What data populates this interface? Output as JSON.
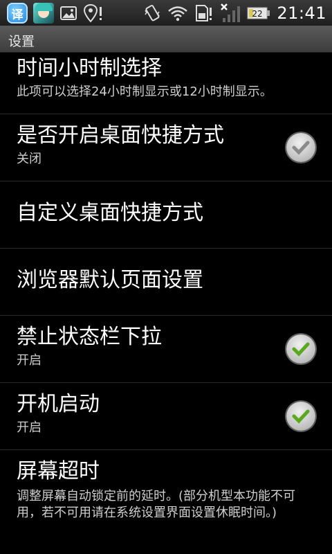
{
  "status_bar": {
    "time": "21:41",
    "battery_level": "22",
    "left_icons": [
      "translate-app-icon",
      "avatar-app-icon",
      "image-icon",
      "location-icon"
    ],
    "right_icons": [
      "vibrate-icon",
      "wifi-icon",
      "sd-card-icon",
      "no-signal-icon",
      "battery-icon"
    ],
    "app_icon_char": "译"
  },
  "title_bar": {
    "title": "设置"
  },
  "settings": [
    {
      "title": "时间小时制选择",
      "subtitle": "此项可以选择24小时制显示或12小时制显示。"
    },
    {
      "title": "是否开启桌面快捷方式",
      "subtitle": "关闭",
      "checked": false
    },
    {
      "title": "自定义桌面快捷方式"
    },
    {
      "title": "浏览器默认页面设置"
    },
    {
      "title": "禁止状态栏下拉",
      "subtitle": "开启",
      "checked": true
    },
    {
      "title": "开机启动",
      "subtitle": "开启",
      "checked": true
    },
    {
      "title": "屏幕超时",
      "subtitle": "调整屏幕自动锁定前的延时。(部分机型本功能不可用，若不可用请在系统设置界面设置休眠时间。)"
    }
  ],
  "colors": {
    "check_green": "#5aa81e",
    "check_gray": "#8a8a8a"
  }
}
